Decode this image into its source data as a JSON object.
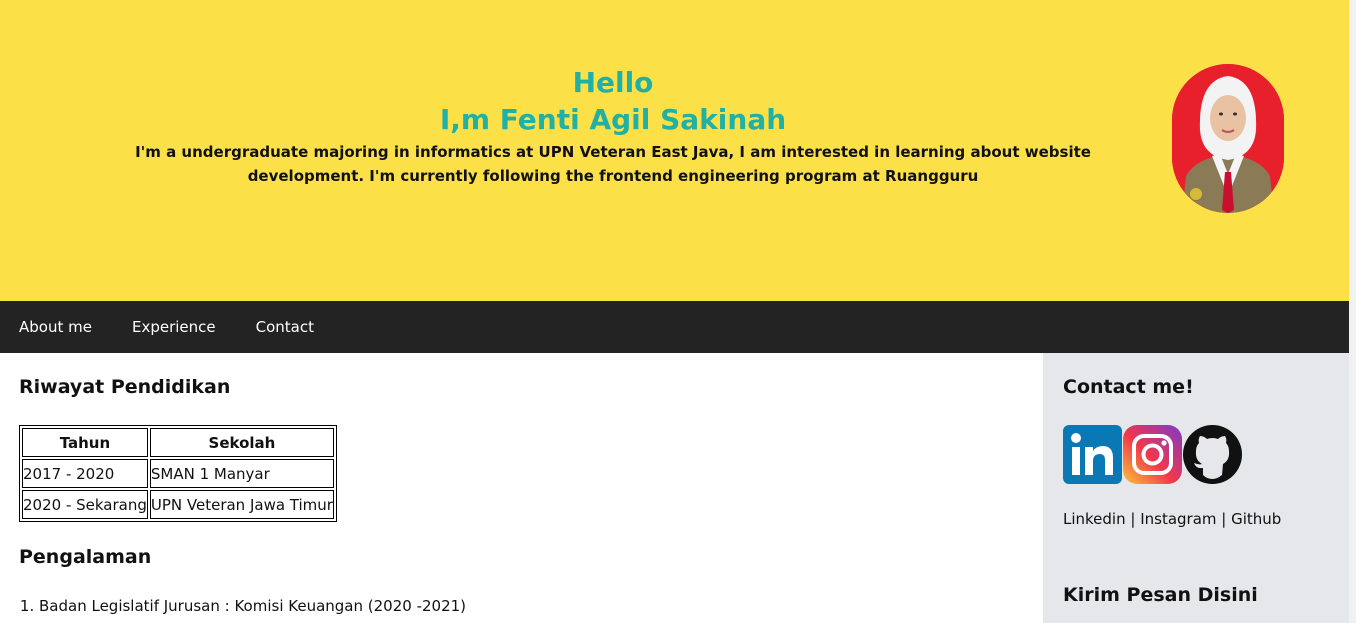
{
  "hero": {
    "hello": "Hello",
    "name": "I,m Fenti Agil Sakinah",
    "description": "I'm a undergraduate majoring in informatics at UPN Veteran East Java, I am interested in learning about website development. I'm currently following the frontend engineering program at Ruangguru"
  },
  "nav": {
    "items": [
      {
        "label": "About me"
      },
      {
        "label": "Experience"
      },
      {
        "label": "Contact"
      }
    ]
  },
  "education": {
    "title": "Riwayat Pendidikan",
    "headers": [
      "Tahun",
      "Sekolah"
    ],
    "rows": [
      [
        "2017 - 2020",
        "SMAN 1 Manyar"
      ],
      [
        "2020 - Sekarang",
        "UPN Veteran Jawa Timur"
      ]
    ]
  },
  "experience": {
    "title": "Pengalaman",
    "items": [
      "Badan Legislatif Jurusan : Komisi Keuangan (2020 -2021)"
    ]
  },
  "contact": {
    "title": "Contact me!",
    "icons": [
      "linkedin-icon",
      "instagram-icon",
      "github-icon"
    ],
    "links": [
      "Linkedin",
      "Instagram",
      "Github"
    ],
    "separator": " | ",
    "message_title": "Kirim Pesan Disini"
  },
  "colors": {
    "hero_bg": "#fce048",
    "accent": "#1fb0a6",
    "nav_bg": "#232323",
    "aside_bg": "#e6e7ea"
  }
}
